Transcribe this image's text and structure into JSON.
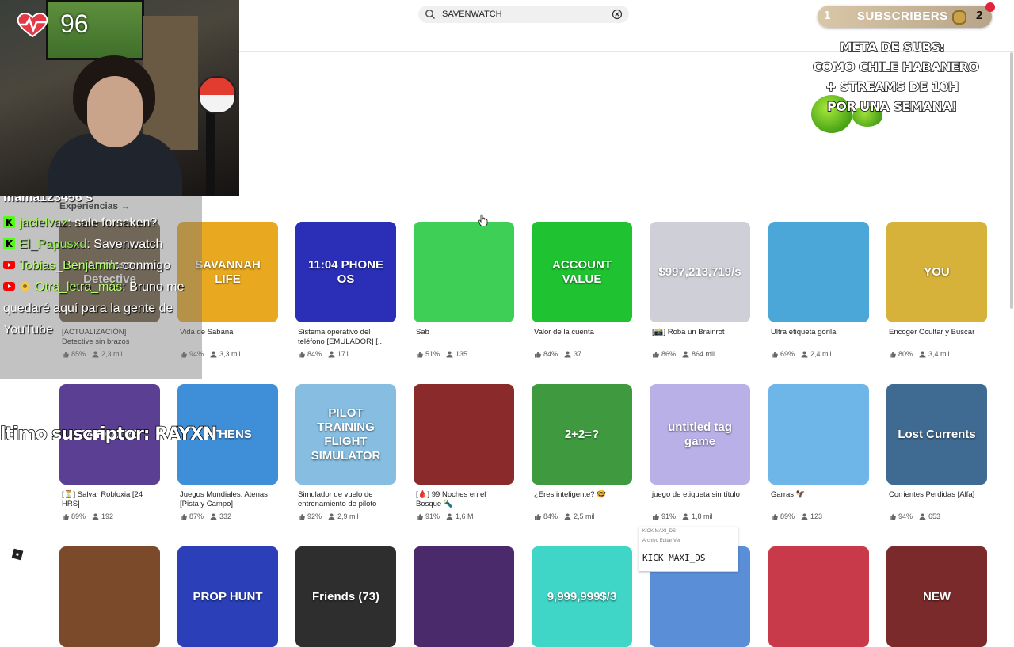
{
  "search": {
    "value": "SAVENWATCH"
  },
  "webcam": {
    "heart_rate": "96"
  },
  "subs_widget": {
    "current": "1",
    "label": "SUBSCRIBERS",
    "goal": "2"
  },
  "sub_goal_text": [
    "META DE SUBS:",
    "COMO CHILE HABANERO",
    "+ STREAMS DE 10H",
    "POR UNA SEMANA!"
  ],
  "section": {
    "title": "Experiencias →"
  },
  "games": [
    {
      "title": "[ACTUALIZACIÓN] Detective sin brazos",
      "rating": "85%",
      "players": "2,3 mil",
      "thumb_text": "Armless Detective",
      "thumb_bg": "#6b5a3e"
    },
    {
      "title": "Vida de Sabana",
      "rating": "94%",
      "players": "3,3 mil",
      "thumb_text": "SAVANNAH LIFE",
      "thumb_bg": "#e8a820"
    },
    {
      "title": "Sistema operativo del teléfono [EMULADOR] [...",
      "rating": "84%",
      "players": "171",
      "thumb_text": "11:04 PHONE OS",
      "thumb_bg": "#2b2fb8"
    },
    {
      "title": "Sab",
      "rating": "51%",
      "players": "135",
      "thumb_text": "",
      "thumb_bg": "#3ecf57"
    },
    {
      "title": "Valor de la cuenta",
      "rating": "84%",
      "players": "37",
      "thumb_text": "ACCOUNT VALUE",
      "thumb_bg": "#1fc331"
    },
    {
      "title": "[📸] Roba un Brainrot",
      "rating": "86%",
      "players": "864 mil",
      "thumb_text": "$997,213,719/s",
      "thumb_bg": "#cfcfd8"
    },
    {
      "title": "Ultra etiqueta gorila",
      "rating": "69%",
      "players": "2,4 mil",
      "thumb_text": "",
      "thumb_bg": "#4aa7d8"
    },
    {
      "title": "Encoger Ocultar y Buscar",
      "rating": "80%",
      "players": "3,4 mil",
      "thumb_text": "YOU",
      "thumb_bg": "#d6b23a"
    },
    {
      "title": "[⏳] Salvar Robloxia [24 HRS]",
      "rating": "89%",
      "players": "192",
      "thumb_text": "24 HOURS",
      "thumb_bg": "#5b3f93"
    },
    {
      "title": "Juegos Mundiales: Atenas [Pista y Campo]",
      "rating": "87%",
      "players": "332",
      "thumb_text": "ATHENS",
      "thumb_bg": "#3f8fd8"
    },
    {
      "title": "Simulador de vuelo de entrenamiento de piloto",
      "rating": "92%",
      "players": "2,9 mil",
      "thumb_text": "PILOT TRAINING FLIGHT SIMULATOR",
      "thumb_bg": "#86bde0"
    },
    {
      "title": "[🩸] 99 Noches en el Bosque 🔦",
      "rating": "91%",
      "players": "1,6 M",
      "thumb_text": "",
      "thumb_bg": "#8a2a2a"
    },
    {
      "title": "¿Eres inteligente? 🤓",
      "rating": "84%",
      "players": "2,5 mil",
      "thumb_text": "2+2=?",
      "thumb_bg": "#3f9a3f"
    },
    {
      "title": "juego de etiqueta sin título",
      "rating": "91%",
      "players": "1,8 mil",
      "thumb_text": "untitled tag game",
      "thumb_bg": "#b9b0e8"
    },
    {
      "title": "Garras 🦅",
      "rating": "89%",
      "players": "123",
      "thumb_text": "",
      "thumb_bg": "#6fb6e8"
    },
    {
      "title": "Corrientes Perdidas [Alfa]",
      "rating": "94%",
      "players": "653",
      "thumb_text": "Lost Currents",
      "thumb_bg": "#3f6a92"
    },
    {
      "thumb_text": "",
      "thumb_bg": "#7a4a2a"
    },
    {
      "thumb_text": "PROP HUNT",
      "thumb_bg": "#2a3fb8"
    },
    {
      "thumb_text": "Friends (73)",
      "thumb_bg": "#2e2e2e"
    },
    {
      "thumb_text": "",
      "thumb_bg": "#4a2a6a"
    },
    {
      "thumb_text": "9,999,999$/3",
      "thumb_bg": "#3fd6c8"
    },
    {
      "thumb_text": "",
      "thumb_bg": "#5a8fd8"
    },
    {
      "thumb_text": "",
      "thumb_bg": "#c83a4a"
    },
    {
      "thumb_text": "NEW",
      "thumb_bg": "#7a2a2a"
    }
  ],
  "chat": {
    "cutoff": "mama123456 s",
    "messages": [
      {
        "platform": "kick-icon",
        "user": "jacielvaz",
        "text": ": sale forsaken?"
      },
      {
        "platform": "kick-icon",
        "user": "El_Papusxd",
        "text": ": Savenwatch"
      },
      {
        "platform": "youtube-icon",
        "user": "Tobias_Benjamin",
        "text": ": conmigo"
      },
      {
        "platform": "youtube-icon",
        "user": "Otra_letra_más",
        "text": ": Bruno me quedaré aquí para la gente de YouTube"
      }
    ]
  },
  "last_subscriber": "ltimo suscriptor: RAYXN",
  "kick_window": {
    "title": "KICK MAXI_DS",
    "menu": "Archivo   Editar   Ver",
    "value": "KICK MAXI_DS"
  }
}
